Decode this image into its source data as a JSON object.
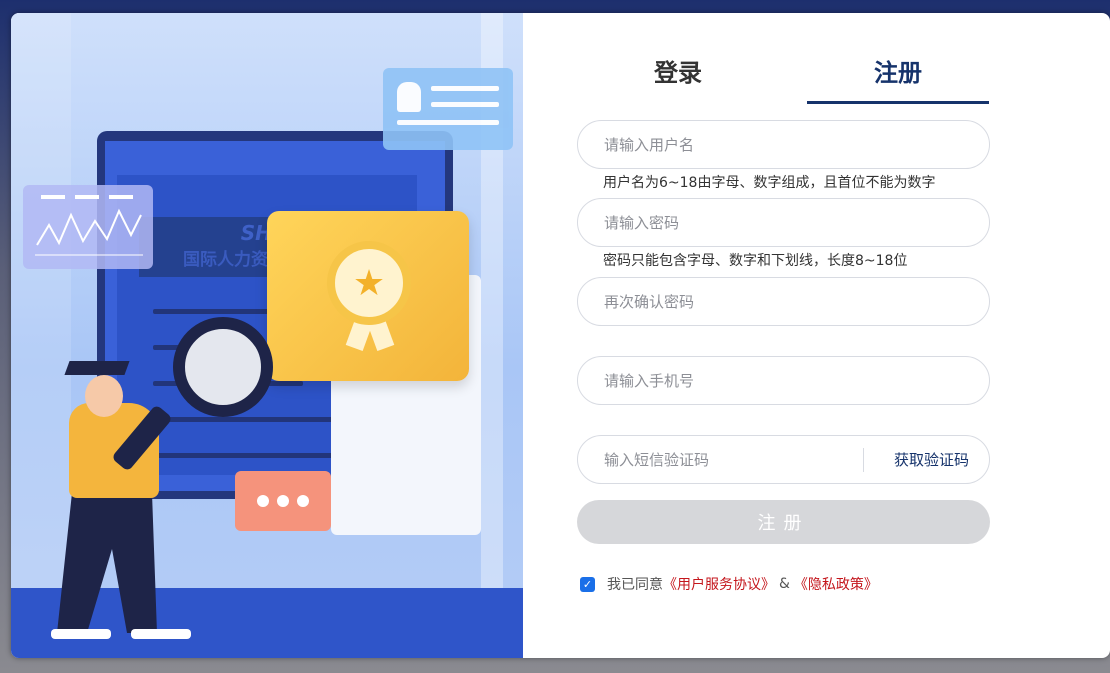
{
  "illustration": {
    "brand_text": "SHRM",
    "brand_subtext": "国际人力资源"
  },
  "tabs": [
    {
      "label": "登录",
      "active": false
    },
    {
      "label": "注册",
      "active": true
    }
  ],
  "form": {
    "username": {
      "placeholder": "请输入用户名",
      "value": "",
      "hint": "用户名为6~18由字母、数字组成，且首位不能为数字"
    },
    "password": {
      "placeholder": "请输入密码",
      "value": "",
      "hint": "密码只能包含字母、数字和下划线，长度8~18位"
    },
    "confirm_password": {
      "placeholder": "再次确认密码",
      "value": ""
    },
    "phone": {
      "placeholder": "请输入手机号",
      "value": ""
    },
    "sms_code": {
      "placeholder": "输入短信验证码",
      "value": "",
      "button_label": "获取验证码"
    },
    "submit_label": "注册",
    "agreement": {
      "checked": true,
      "prefix": "我已同意",
      "terms_link": "《用户服务协议》",
      "separator": "&",
      "privacy_link": "《隐私政策》"
    }
  },
  "colors": {
    "accent": "#16336b",
    "checkbox": "#1a6fe8",
    "link": "#c4161c",
    "submit_disabled": "#d6d7da"
  }
}
